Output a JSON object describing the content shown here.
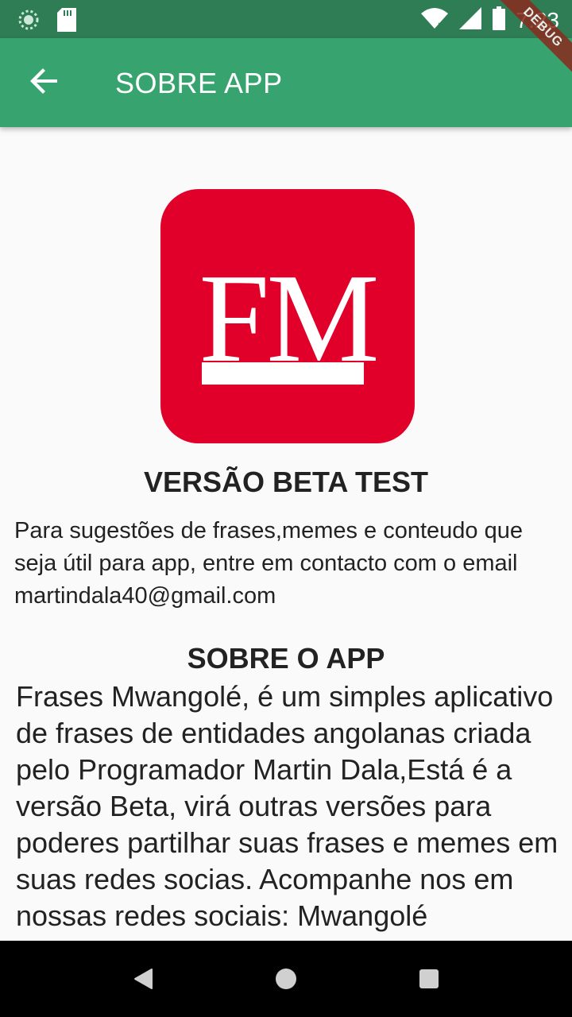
{
  "status_bar": {
    "time": "7:23",
    "icons": [
      "loading-icon",
      "sd-card-icon",
      "wifi-icon",
      "signal-icon",
      "battery-icon"
    ],
    "debug_label": "DEBUG"
  },
  "app_bar": {
    "title": "SOBRE APP",
    "back_icon": "arrow-back-icon",
    "color": "#37a46f"
  },
  "logo": {
    "text": "FM",
    "color": "#e0002a"
  },
  "version": {
    "title": "VERSÃO BETA TEST",
    "suggestion": "Para sugestões de frases,memes e conteudo que seja útil para app, entre em contacto com o email martindala40@gmail.com"
  },
  "about": {
    "title": "SOBRE O APP",
    "body": "Frases Mwangolé, é um simples aplicativo de frases de entidades angolanas criada pelo Programador Martin Dala,Está é a versão Beta, virá outras versões para poderes partilhar suas frases e memes em suas redes socias. Acompanhe nos em nossas redes sociais: Mwangolé"
  },
  "nav_bar": {
    "icons": [
      "back-triangle-icon",
      "home-circle-icon",
      "recents-square-icon"
    ]
  }
}
